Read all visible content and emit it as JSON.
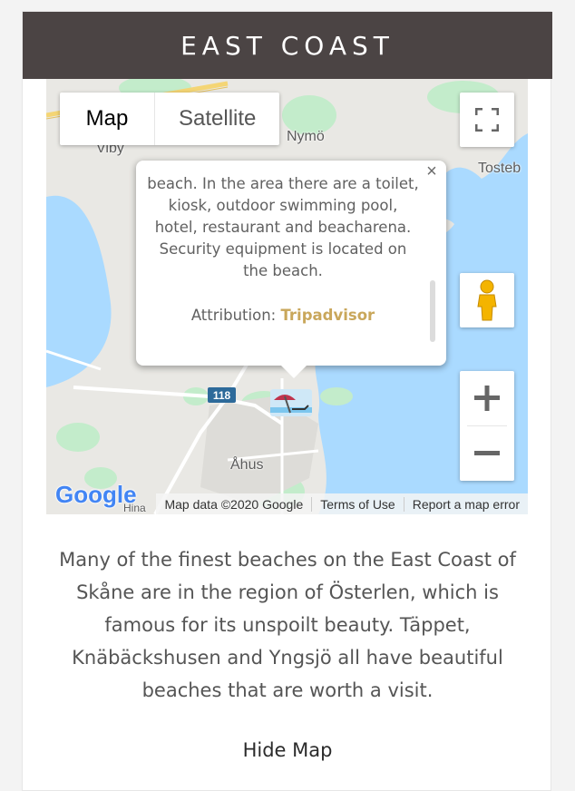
{
  "section": {
    "title": "EAST COAST"
  },
  "map": {
    "type_buttons": {
      "map": "Map",
      "satellite": "Satellite"
    },
    "places": {
      "viby": "Viby",
      "nymo": "Nymö",
      "tosteb": "Tosteb",
      "ahus": "Åhus",
      "hina": "Hina"
    },
    "road_number": "118",
    "info_window": {
      "close": "×",
      "text": "beach. In the area there are a toilet, kiosk, outdoor swimming pool, hotel, restaurant and beacharena. Security equipment is located on the beach.",
      "attribution_label": "Attribution: ",
      "attribution_link": "Tripadvisor"
    },
    "logo": "Google",
    "footer": {
      "map_data": "Map data ©2020 Google",
      "terms": "Terms of Use",
      "report": "Report a map error"
    },
    "controls": {
      "fullscreen_icon": "fullscreen-icon",
      "pegman_icon": "pegman-icon",
      "zoom_in_icon": "plus-icon",
      "zoom_out_icon": "minus-icon"
    }
  },
  "description": "Many of the finest beaches on the East Coast of Skåne are in the region of Österlen, which is famous for its unspoilt beauty. Täppet, Knäbäckshusen and Yngsjö all have beautiful beaches that are worth a visit.",
  "hide_map_label": "Hide Map",
  "colors": {
    "header_bg": "#4b4444",
    "water": "#aadaff",
    "land": "#e9e8e4",
    "park": "#c3eccb",
    "link": "#c9a75b"
  }
}
